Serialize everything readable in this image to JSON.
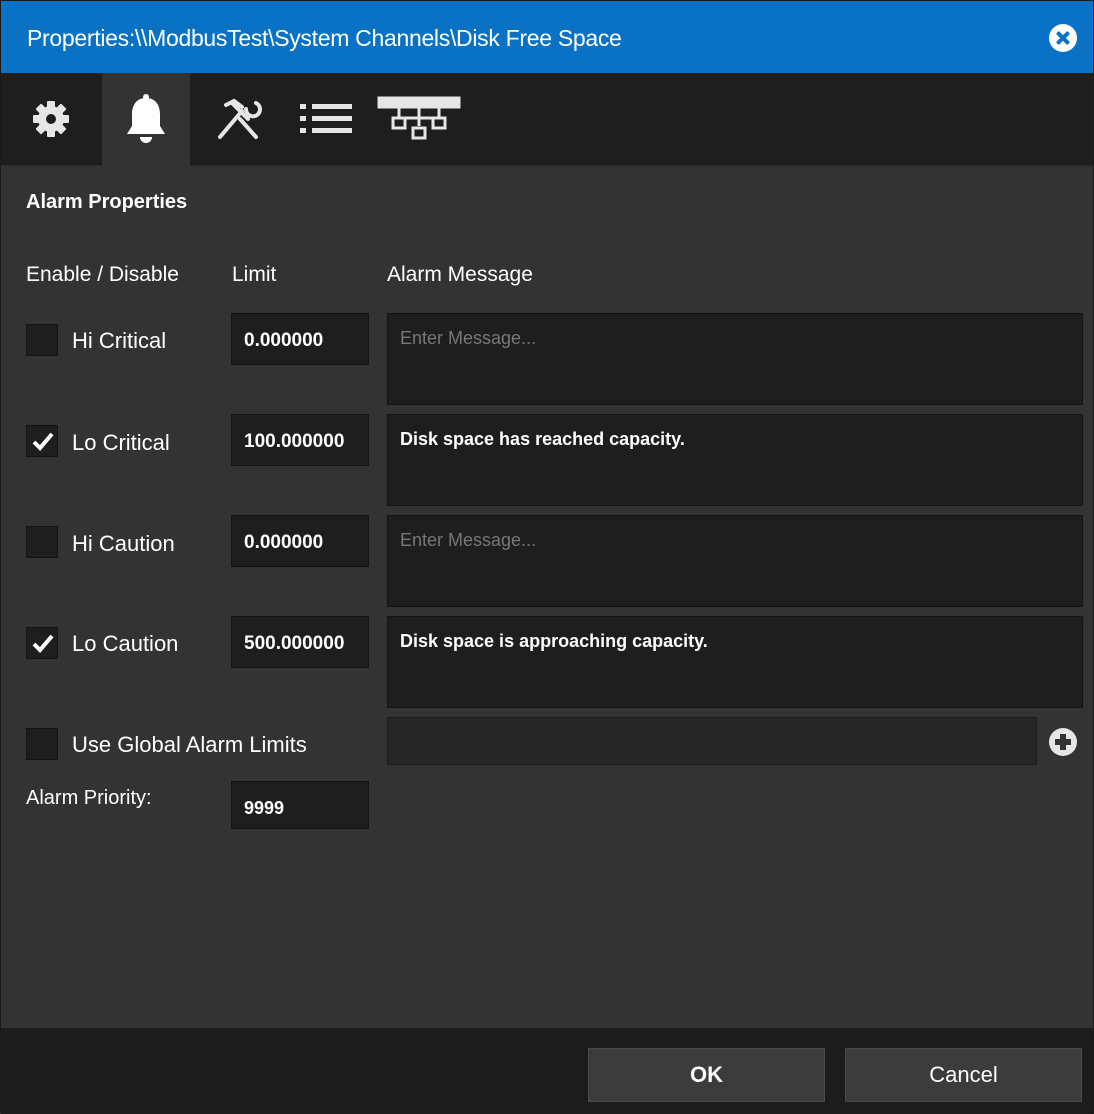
{
  "window": {
    "title": "Properties:\\\\ModbusTest\\System Channels\\Disk Free Space",
    "close_icon": "close-circle-icon"
  },
  "tabs": [
    {
      "icon": "gear-icon",
      "active": false
    },
    {
      "icon": "bell-icon",
      "active": true
    },
    {
      "icon": "tools-icon",
      "active": false
    },
    {
      "icon": "list-icon",
      "active": false
    },
    {
      "icon": "network-icon",
      "active": false
    }
  ],
  "section": {
    "title": "Alarm Properties"
  },
  "columns": {
    "enable": "Enable / Disable",
    "limit": "Limit",
    "message": "Alarm Message"
  },
  "alarms": [
    {
      "label": "Hi Critical",
      "checked": false,
      "limit": "0.000000",
      "message": "",
      "placeholder": "Enter Message..."
    },
    {
      "label": "Lo Critical",
      "checked": true,
      "limit": "100.000000",
      "message": "Disk space has reached capacity.",
      "placeholder": "Enter Message..."
    },
    {
      "label": "Hi Caution",
      "checked": false,
      "limit": "0.000000",
      "message": "",
      "placeholder": "Enter Message..."
    },
    {
      "label": "Lo Caution",
      "checked": true,
      "limit": "500.000000",
      "message": "Disk space is approaching capacity.",
      "placeholder": "Enter Message..."
    }
  ],
  "global_limits": {
    "label": "Use Global Alarm Limits",
    "checked": false,
    "value": "",
    "add_icon": "plus-circle-icon"
  },
  "priority": {
    "label": "Alarm Priority:",
    "value": "9999"
  },
  "buttons": {
    "ok": "OK",
    "cancel": "Cancel"
  },
  "colors": {
    "titlebar": "#0a72c4",
    "background": "#333333",
    "tabbar": "#1e1e1e"
  }
}
